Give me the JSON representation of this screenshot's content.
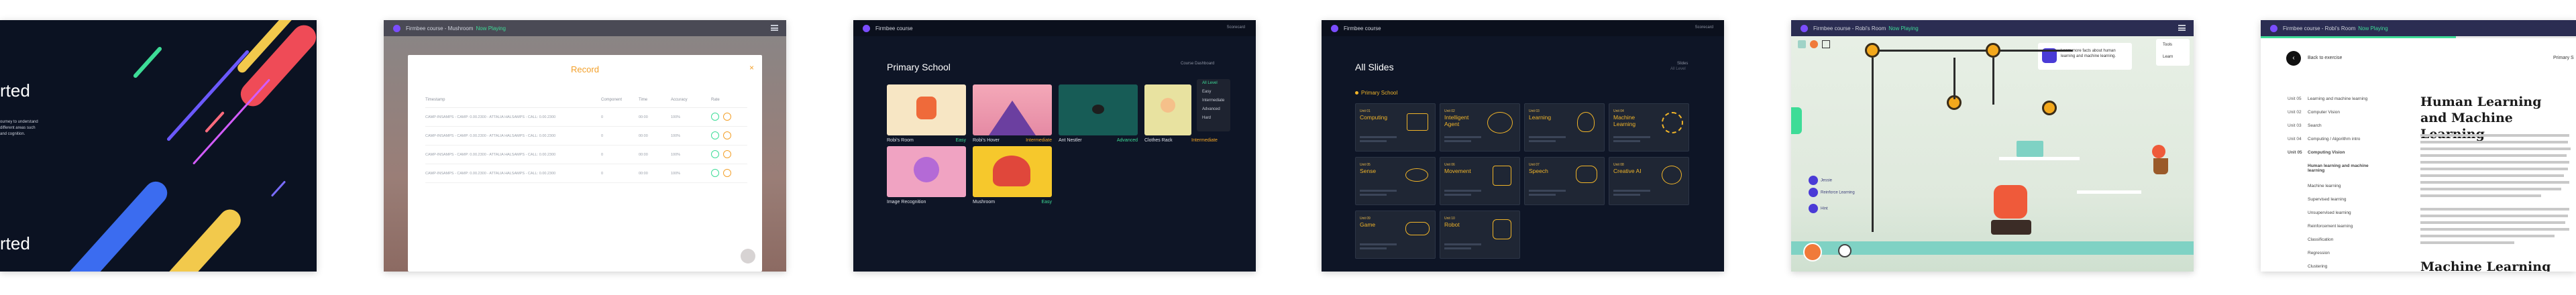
{
  "colors": {
    "dark_bg": "#0e1526",
    "accent_green": "#3ddc97",
    "accent_orange": "#f5a623",
    "accent_yellow": "#f0b429",
    "logo_purple": "#7b4dff",
    "record_title": "#f3a02a"
  },
  "panel1": {
    "heading_partial": "rted",
    "heading_partial_bottom": "rted",
    "text_lines": [
      "ourney to understand",
      "different areas such",
      "and cognition."
    ]
  },
  "panel2": {
    "app_title": "Firmbee course - Mushroom",
    "app_status": "Now Playing",
    "modal_title": "Record",
    "close_icon": "close-icon",
    "columns": [
      "Timestamp",
      "Component",
      "Time",
      "Accuracy",
      "Rate"
    ],
    "rows": [
      {
        "timestamp": "CAMP-INSAMPS - CAMP: 0.00.2300 - ATTALIA HALSAMPS - CALL: 0.00.2300",
        "component": "0",
        "time": "00:00",
        "accuracy": "100%"
      },
      {
        "timestamp": "CAMP-INSAMPS - CAMP: 0.00.2300 - ATTALIA HALSAMPS - CALL: 0.00.2300",
        "component": "0",
        "time": "00:00",
        "accuracy": "100%"
      },
      {
        "timestamp": "CAMP-INSAMPS - CAMP: 0.00.2300 - ATTALIA HALSAMPS - CALL: 0.00.2300",
        "component": "0",
        "time": "00:00",
        "accuracy": "100%"
      },
      {
        "timestamp": "CAMP-INSAMPS - CAMP: 0.00.2300 - ATTALIA HALSAMPS - CALL: 0.00.2300",
        "component": "0",
        "time": "00:00",
        "accuracy": "100%"
      }
    ]
  },
  "panel3": {
    "app_title": "Firmbee course",
    "user_menu": "Scorecard",
    "section_title": "Primary School",
    "filter_label": "Course Dashboard",
    "filter_sub": "All Level",
    "dropdown_options": [
      "All Level",
      "Easy",
      "Intermediate",
      "Advanced",
      "Hard"
    ],
    "cards": [
      {
        "name": "Robi's Room",
        "level": "Easy"
      },
      {
        "name": "Robi's Hover",
        "level": "Intermediate"
      },
      {
        "name": "Ant Nestler",
        "level": "Advanced"
      },
      {
        "name": "Clothes Rack",
        "level": "Intermediate"
      },
      {
        "name": "Image Recognition",
        "level": "Easy"
      },
      {
        "name": "Mushroom",
        "level": "Easy"
      }
    ]
  },
  "panel4": {
    "app_title": "Firmbee course",
    "user_menu": "Scorecard",
    "section_title": "All Slides",
    "filter_label": "Slides",
    "filter_sub": "All Level",
    "category": "Primary School",
    "slides": [
      {
        "num": "Unit 01",
        "title": "Computing"
      },
      {
        "num": "Unit 02",
        "title": "Intelligent Agent"
      },
      {
        "num": "Unit 03",
        "title": "Learning"
      },
      {
        "num": "Unit 04",
        "title": "Machine Learning"
      },
      {
        "num": "Unit 05",
        "title": "Sense"
      },
      {
        "num": "Unit 06",
        "title": "Movement"
      },
      {
        "num": "Unit 07",
        "title": "Speech"
      },
      {
        "num": "Unit 08",
        "title": "Creative AI"
      },
      {
        "num": "Unit 09",
        "title": "Game"
      },
      {
        "num": "Unit 10",
        "title": "Robot"
      }
    ]
  },
  "panel5": {
    "app_title": "Firmbee course - Robi's Room",
    "app_status": "Now Playing",
    "info_text": "Learn more facts about human learning and machine learning.",
    "menu_items": [
      "Tools",
      "Learn"
    ],
    "nav_items": [
      "Jessie",
      "Reinforce Learning",
      "Hint"
    ]
  },
  "panel6": {
    "app_title": "Firmbee course - Robi's Room",
    "app_status": "Now Playing",
    "back_label": "Back to exercise",
    "right_label": "Primary S",
    "toc": [
      {
        "num": "Unit 05",
        "label": "Learning and machine learning"
      },
      {
        "num": "Unit 02",
        "label": "Computer Vision"
      },
      {
        "num": "Unit 03",
        "label": "Search"
      },
      {
        "num": "Unit 04",
        "label": "Computing / Algorithm intro"
      },
      {
        "num": "Unit 05",
        "label": "Computing Vision"
      },
      {
        "num": "",
        "label": "Human learning and machine learning"
      },
      {
        "num": "",
        "label": "Machine learning"
      },
      {
        "num": "",
        "label": "Supervised learning"
      },
      {
        "num": "",
        "label": "Unsupervised learning"
      },
      {
        "num": "",
        "label": "Reinforcement learning"
      },
      {
        "num": "",
        "label": "Classification"
      },
      {
        "num": "",
        "label": "Regression"
      },
      {
        "num": "",
        "label": "Clustering"
      }
    ],
    "heading": "Human Learning and Machine Learning",
    "heading2": "Machine Learning"
  }
}
